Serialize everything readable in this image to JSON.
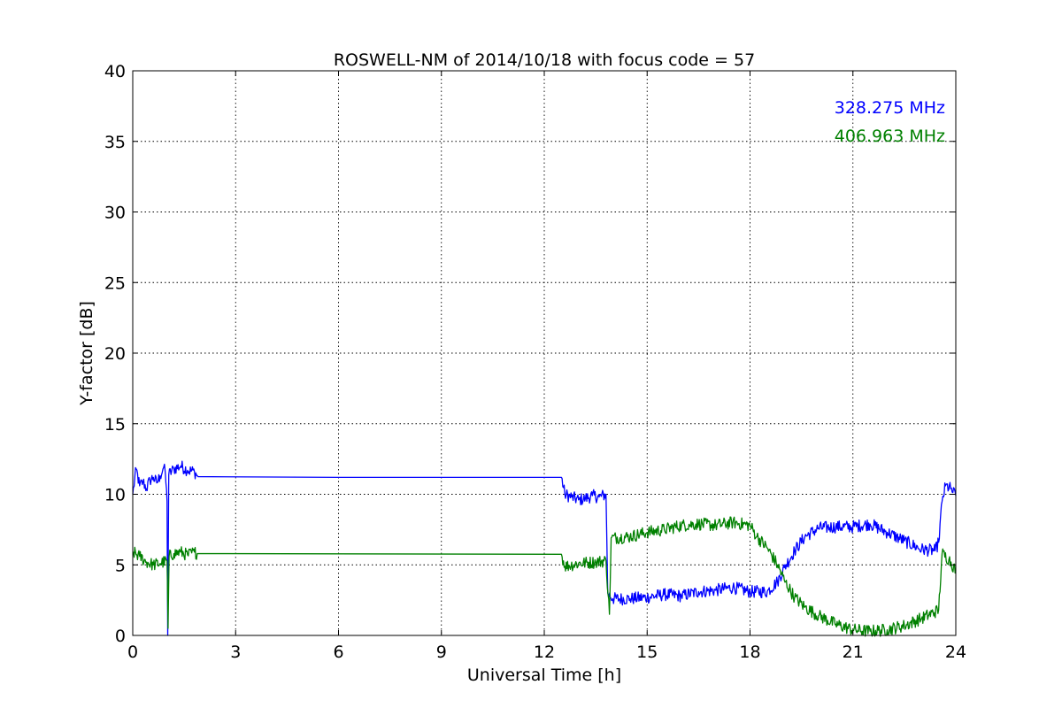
{
  "chart_data": {
    "type": "line",
    "title": "ROSWELL-NM of 2014/10/18 with focus code = 57",
    "xlabel": "Universal Time [h]",
    "ylabel": "Y-factor [dB]",
    "xlim": [
      0,
      24
    ],
    "ylim": [
      0,
      40
    ],
    "xticks": [
      0,
      3,
      6,
      9,
      12,
      15,
      18,
      21,
      24
    ],
    "yticks": [
      0,
      5,
      10,
      15,
      20,
      25,
      30,
      35,
      40
    ],
    "grid": true,
    "legend_position": "top-right",
    "series": [
      {
        "name": "328.275 MHz",
        "color": "#0000ff",
        "points": [
          [
            0.0,
            10.0
          ],
          [
            0.1,
            11.8
          ],
          [
            0.2,
            10.6
          ],
          [
            0.3,
            10.9
          ],
          [
            0.4,
            10.4
          ],
          [
            0.5,
            11.0
          ],
          [
            0.6,
            11.2
          ],
          [
            0.7,
            10.8
          ],
          [
            0.8,
            11.3
          ],
          [
            0.9,
            11.9
          ],
          [
            0.95,
            11.5
          ],
          [
            1.0,
            9.5
          ],
          [
            1.02,
            0.0
          ],
          [
            1.05,
            11.4
          ],
          [
            1.2,
            11.8
          ],
          [
            1.4,
            12.0
          ],
          [
            1.6,
            11.7
          ],
          [
            1.8,
            11.6
          ],
          [
            1.9,
            11.25
          ],
          [
            6.0,
            11.2
          ],
          [
            12.5,
            11.2
          ],
          [
            12.6,
            10.0
          ],
          [
            12.8,
            9.8
          ],
          [
            13.0,
            9.6
          ],
          [
            13.2,
            9.7
          ],
          [
            13.4,
            9.9
          ],
          [
            13.6,
            9.8
          ],
          [
            13.8,
            10.0
          ],
          [
            13.85,
            3.0
          ],
          [
            14.0,
            2.6
          ],
          [
            14.5,
            2.6
          ],
          [
            15.0,
            2.7
          ],
          [
            15.5,
            2.9
          ],
          [
            16.0,
            2.8
          ],
          [
            16.5,
            3.1
          ],
          [
            17.0,
            3.2
          ],
          [
            17.5,
            3.4
          ],
          [
            18.0,
            3.1
          ],
          [
            18.5,
            3.1
          ],
          [
            18.8,
            3.8
          ],
          [
            19.0,
            4.8
          ],
          [
            19.3,
            6.0
          ],
          [
            19.6,
            7.0
          ],
          [
            20.0,
            7.6
          ],
          [
            20.5,
            7.7
          ],
          [
            21.0,
            7.7
          ],
          [
            21.5,
            7.9
          ],
          [
            22.0,
            7.3
          ],
          [
            22.5,
            6.7
          ],
          [
            23.0,
            6.1
          ],
          [
            23.4,
            6.0
          ],
          [
            23.5,
            6.6
          ],
          [
            23.6,
            9.5
          ],
          [
            23.7,
            10.6
          ],
          [
            23.85,
            10.4
          ],
          [
            24.0,
            9.9
          ]
        ]
      },
      {
        "name": "406.963 MHz",
        "color": "#008000",
        "points": [
          [
            0.0,
            5.9
          ],
          [
            0.2,
            5.6
          ],
          [
            0.4,
            5.2
          ],
          [
            0.6,
            5.0
          ],
          [
            0.8,
            5.1
          ],
          [
            1.0,
            5.3
          ],
          [
            1.03,
            0.5
          ],
          [
            1.06,
            5.6
          ],
          [
            1.2,
            5.8
          ],
          [
            1.4,
            5.9
          ],
          [
            1.6,
            5.7
          ],
          [
            1.8,
            5.9
          ],
          [
            1.9,
            5.8
          ],
          [
            6.0,
            5.78
          ],
          [
            12.5,
            5.75
          ],
          [
            12.6,
            4.9
          ],
          [
            13.0,
            5.1
          ],
          [
            13.5,
            5.2
          ],
          [
            13.8,
            5.3
          ],
          [
            13.9,
            1.5
          ],
          [
            13.95,
            6.9
          ],
          [
            14.5,
            7.0
          ],
          [
            15.0,
            7.3
          ],
          [
            15.5,
            7.5
          ],
          [
            16.0,
            7.8
          ],
          [
            16.5,
            7.9
          ],
          [
            17.0,
            7.8
          ],
          [
            17.5,
            8.0
          ],
          [
            18.0,
            7.8
          ],
          [
            18.2,
            7.0
          ],
          [
            18.5,
            6.2
          ],
          [
            18.8,
            5.0
          ],
          [
            19.0,
            3.9
          ],
          [
            19.3,
            2.7
          ],
          [
            19.6,
            2.0
          ],
          [
            20.0,
            1.4
          ],
          [
            20.5,
            0.8
          ],
          [
            21.0,
            0.4
          ],
          [
            21.5,
            0.3
          ],
          [
            22.0,
            0.4
          ],
          [
            22.5,
            0.7
          ],
          [
            23.0,
            1.2
          ],
          [
            23.5,
            1.8
          ],
          [
            23.6,
            5.8
          ],
          [
            23.8,
            5.4
          ],
          [
            24.0,
            4.6
          ]
        ]
      }
    ]
  }
}
